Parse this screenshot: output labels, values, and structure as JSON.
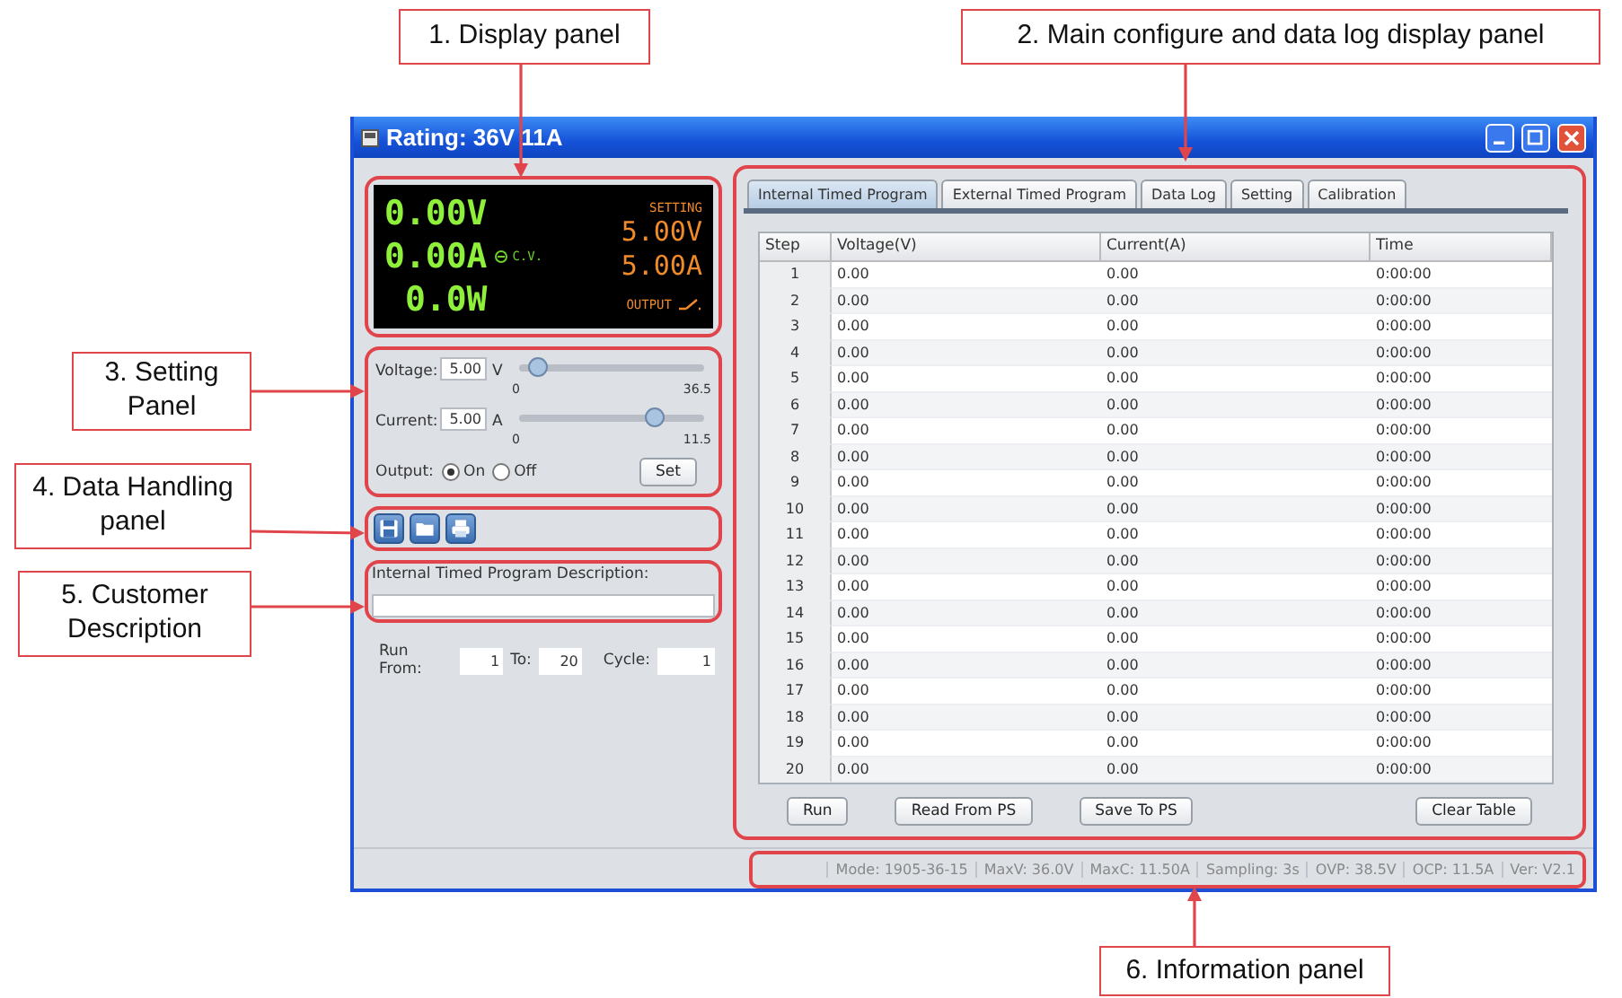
{
  "callouts": [
    {
      "label": "1. Display panel"
    },
    {
      "label": "2. Main configure and data log display panel"
    },
    {
      "label": "3. Setting Panel"
    },
    {
      "label": "4. Data Handling panel"
    },
    {
      "label": "5. Customer Description"
    },
    {
      "label": "6. Information panel"
    }
  ],
  "window": {
    "title": "Rating: 36V 11A"
  },
  "display": {
    "voltage": "0.00V",
    "current": "0.00A",
    "power": "0.0W",
    "mode": "C.V.",
    "setting_label": "SETTING",
    "set_voltage": "5.00V",
    "set_current": "5.00A",
    "output_label": "OUTPUT",
    "output_on": false
  },
  "setting": {
    "sliders": [
      {
        "label": "Voltage:",
        "value": "5.00",
        "unit": "V",
        "level": 0.1,
        "min": "0",
        "max": "36.5"
      },
      {
        "label": "Current:",
        "value": "5.00",
        "unit": "A",
        "level": 0.73,
        "min": "0",
        "max": "11.5"
      }
    ],
    "output": {
      "label": "Output:",
      "options": [
        {
          "label": "On",
          "selected": true
        },
        {
          "label": "Off",
          "selected": false
        }
      ]
    },
    "set_button": "Set"
  },
  "description": {
    "label": "Internal Timed Program Description:"
  },
  "run_range": {
    "from_label": "Run From:",
    "from": "1",
    "to_label": "To:",
    "to": "20",
    "cycle_label": "Cycle:",
    "cycle": "1"
  },
  "tabs": [
    {
      "label": "Internal Timed Program",
      "selected": true
    },
    {
      "label": "External Timed Program",
      "selected": false
    },
    {
      "label": "Data Log",
      "selected": false
    },
    {
      "label": "Setting",
      "selected": false
    },
    {
      "label": "Calibration",
      "selected": false
    }
  ],
  "table": {
    "columns": [
      "Step",
      "Voltage(V)",
      "Current(A)",
      "Time"
    ],
    "rows": [
      [
        "1",
        "0.00",
        "0.00",
        "0:00:00"
      ],
      [
        "2",
        "0.00",
        "0.00",
        "0:00:00"
      ],
      [
        "3",
        "0.00",
        "0.00",
        "0:00:00"
      ],
      [
        "4",
        "0.00",
        "0.00",
        "0:00:00"
      ],
      [
        "5",
        "0.00",
        "0.00",
        "0:00:00"
      ],
      [
        "6",
        "0.00",
        "0.00",
        "0:00:00"
      ],
      [
        "7",
        "0.00",
        "0.00",
        "0:00:00"
      ],
      [
        "8",
        "0.00",
        "0.00",
        "0:00:00"
      ],
      [
        "9",
        "0.00",
        "0.00",
        "0:00:00"
      ],
      [
        "10",
        "0.00",
        "0.00",
        "0:00:00"
      ],
      [
        "11",
        "0.00",
        "0.00",
        "0:00:00"
      ],
      [
        "12",
        "0.00",
        "0.00",
        "0:00:00"
      ],
      [
        "13",
        "0.00",
        "0.00",
        "0:00:00"
      ],
      [
        "14",
        "0.00",
        "0.00",
        "0:00:00"
      ],
      [
        "15",
        "0.00",
        "0.00",
        "0:00:00"
      ],
      [
        "16",
        "0.00",
        "0.00",
        "0:00:00"
      ],
      [
        "17",
        "0.00",
        "0.00",
        "0:00:00"
      ],
      [
        "18",
        "0.00",
        "0.00",
        "0:00:00"
      ],
      [
        "19",
        "0.00",
        "0.00",
        "0:00:00"
      ],
      [
        "20",
        "0.00",
        "0.00",
        "0:00:00"
      ]
    ]
  },
  "buttons": [
    {
      "label": "Run",
      "kind": "left"
    },
    {
      "label": "Read From PS",
      "kind": "left"
    },
    {
      "label": "Save To PS",
      "kind": "left"
    },
    {
      "label": "Clear Table",
      "kind": "right"
    }
  ],
  "status_bar": [
    "Mode: 1905-36-15",
    "MaxV: 36.0V",
    "MaxC: 11.50A",
    "Sampling: 3s",
    "OVP: 38.5V",
    "OCP: 11.5A",
    "Ver: V2.1"
  ]
}
